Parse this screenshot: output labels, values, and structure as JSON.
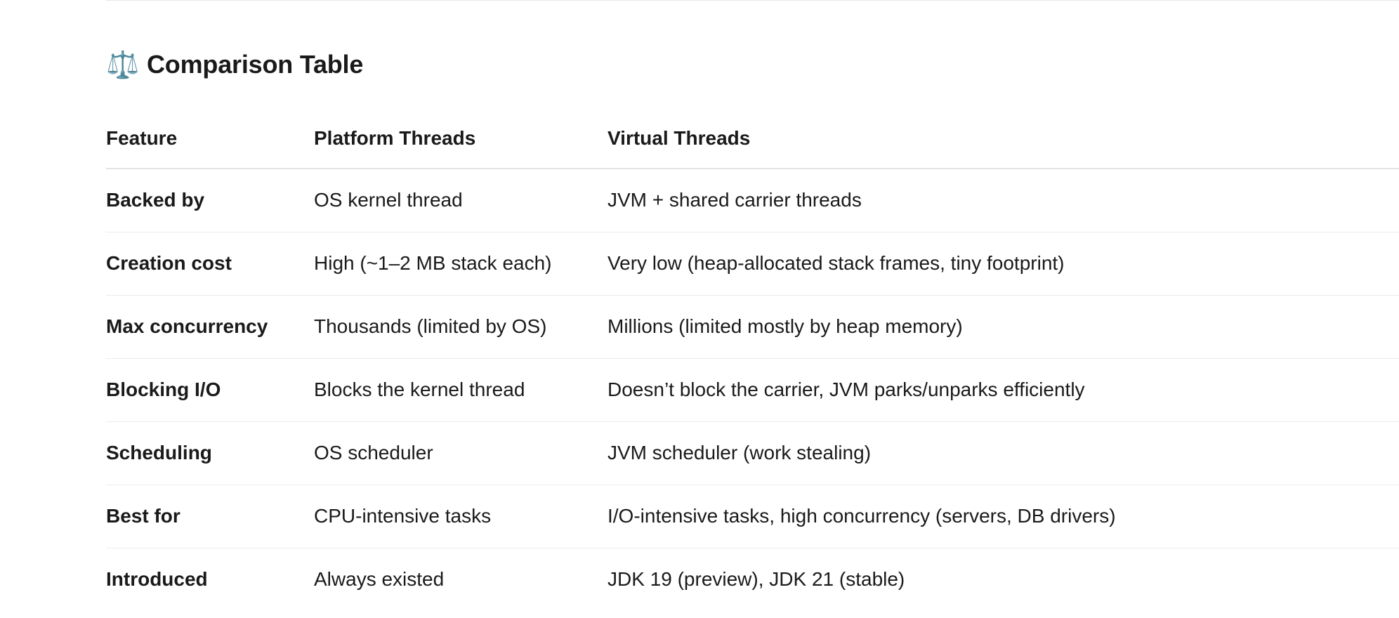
{
  "section": {
    "icon": "balance-scale-icon",
    "icon_glyph": "⚖️",
    "title": "Comparison Table"
  },
  "table": {
    "headers": [
      "Feature",
      "Platform Threads",
      "Virtual Threads"
    ],
    "rows": [
      [
        "Backed by",
        "OS kernel thread",
        "JVM + shared carrier threads"
      ],
      [
        "Creation cost",
        "High (~1–2 MB stack each)",
        "Very low (heap-allocated stack frames, tiny footprint)"
      ],
      [
        "Max concurrency",
        "Thousands (limited by OS)",
        "Millions (limited mostly by heap memory)"
      ],
      [
        "Blocking I/O",
        "Blocks the kernel thread",
        "Doesn’t block the carrier, JVM parks/unparks efficiently"
      ],
      [
        "Scheduling",
        "OS scheduler",
        "JVM scheduler (work stealing)"
      ],
      [
        "Best for",
        "CPU-intensive tasks",
        "I/O-intensive tasks, high concurrency (servers, DB drivers)"
      ],
      [
        "Introduced",
        "Always existed",
        "JDK 19 (preview), JDK 21 (stable)"
      ]
    ]
  }
}
